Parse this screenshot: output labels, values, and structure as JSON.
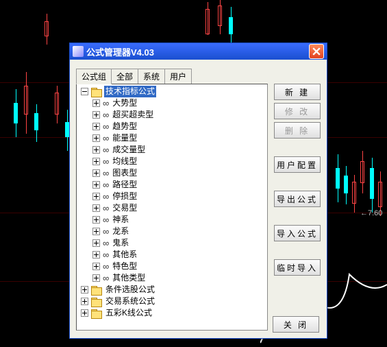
{
  "background": {
    "price_label": "←7.60"
  },
  "dialog": {
    "title": "公式管理器V4.03",
    "tabs": [
      "公式组",
      "全部",
      "系统",
      "用户"
    ],
    "active_tab": 0,
    "tree": {
      "root_label": "技术指标公式",
      "root_selected": true,
      "children": [
        "大势型",
        "超买超卖型",
        "趋势型",
        "能量型",
        "成交量型",
        "均线型",
        "图表型",
        "路径型",
        "停损型",
        "交易型",
        "神系",
        "龙系",
        "鬼系",
        "其他系",
        "特色型",
        "其他类型"
      ],
      "siblings": [
        "条件选股公式",
        "交易系统公式",
        "五彩K线公式"
      ]
    },
    "buttons": {
      "new": "新  建",
      "edit": "修  改",
      "delete": "删  除",
      "user_cfg": "用户配置",
      "export": "导出公式",
      "import": "导入公式",
      "temp_import": "临时导入",
      "close": "关  闭"
    }
  }
}
